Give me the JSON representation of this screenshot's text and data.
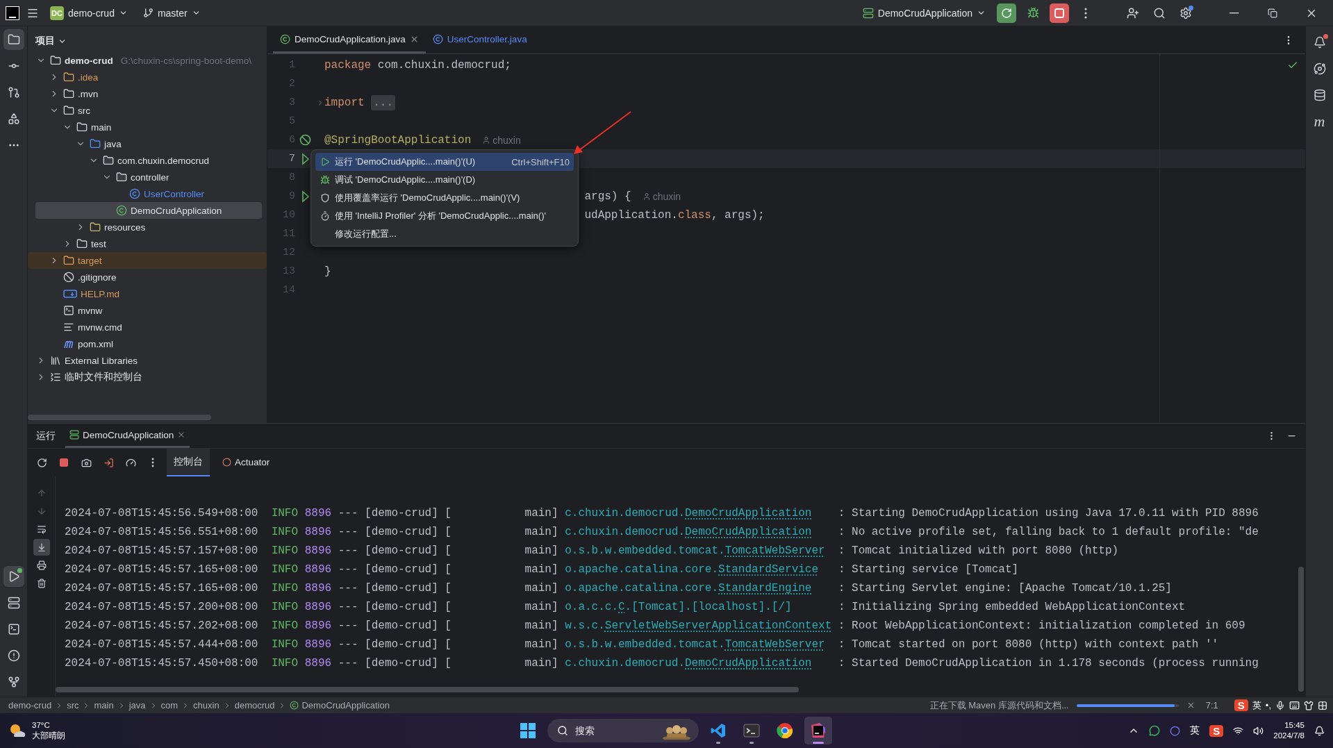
{
  "title_bar": {
    "project_badge": "DC",
    "project": "demo-crud",
    "branch": "master",
    "run_config": "DemoCrudApplication"
  },
  "left_tools": {
    "top": [
      {
        "kind": "project",
        "selected": true
      },
      {
        "kind": "commit",
        "selected": false
      },
      {
        "kind": "pull-requests",
        "selected": false
      },
      {
        "kind": "structure",
        "selected": false
      },
      {
        "kind": "more",
        "selected": false
      }
    ],
    "bottom": [
      {
        "kind": "run",
        "selected": true
      },
      {
        "kind": "services",
        "selected": false
      },
      {
        "kind": "terminal",
        "selected": false
      },
      {
        "kind": "problems",
        "selected": false
      },
      {
        "kind": "git",
        "selected": false
      }
    ]
  },
  "right_tools": [
    {
      "kind": "notifications"
    },
    {
      "kind": "assistant"
    },
    {
      "kind": "database"
    },
    {
      "kind": "maven",
      "glyph": "m"
    }
  ],
  "project": {
    "title": "项目",
    "tree": [
      {
        "name": "demo-crud",
        "path": "G:\\chuxin-cs\\spring-boot-demo\\",
        "kind": "module",
        "expanded": true,
        "selected": false,
        "children": [
          {
            "name": ".idea",
            "kind": "folder",
            "color": "#d69a5a",
            "expanded": false,
            "selected": false
          },
          {
            "name": ".mvn",
            "kind": "folder",
            "expanded": false,
            "selected": false
          },
          {
            "name": "src",
            "kind": "folder",
            "expanded": true,
            "selected": false,
            "children": [
              {
                "name": "main",
                "kind": "folder",
                "expanded": true,
                "selected": false,
                "children": [
                  {
                    "name": "java",
                    "kind": "source",
                    "expanded": true,
                    "selected": false,
                    "children": [
                      {
                        "name": "com.chuxin.democrud",
                        "kind": "package",
                        "expanded": true,
                        "selected": false,
                        "children": [
                          {
                            "name": "controller",
                            "kind": "package",
                            "expanded": true,
                            "selected": false,
                            "children": [
                              {
                                "name": "UserController",
                                "kind": "class",
                                "color": "#548af7",
                                "selected": false
                              }
                            ]
                          },
                          {
                            "name": "DemoCrudApplication",
                            "kind": "spring-class",
                            "selected": true
                          }
                        ]
                      }
                    ]
                  },
                  {
                    "name": "resources",
                    "kind": "resources",
                    "expanded": false,
                    "selected": false
                  }
                ]
              },
              {
                "name": "test",
                "kind": "folder",
                "expanded": false,
                "selected": false
              }
            ]
          },
          {
            "name": "target",
            "kind": "folder",
            "color": "#d69a5a",
            "excluded": true,
            "expanded": false,
            "selected": false
          },
          {
            "name": ".gitignore",
            "kind": "ignore",
            "selected": false
          },
          {
            "name": "HELP.md",
            "kind": "markdown",
            "color": "#d69a5a",
            "selected": false
          },
          {
            "name": "mvnw",
            "kind": "script",
            "selected": false
          },
          {
            "name": "mvnw.cmd",
            "kind": "text",
            "selected": false
          },
          {
            "name": "pom.xml",
            "kind": "maven",
            "selected": false
          }
        ]
      },
      {
        "name": "External Libraries",
        "kind": "libraries",
        "expanded": false,
        "selected": false
      },
      {
        "name": "临时文件和控制台",
        "kind": "scratches",
        "expanded": false,
        "selected": false
      }
    ]
  },
  "editor": {
    "tabs": [
      {
        "label": "DemoCrudApplication.java",
        "kind": "spring-class",
        "selected": true
      },
      {
        "label": "UserController.java",
        "kind": "class",
        "selected": false
      }
    ],
    "lines": [
      {
        "number": "1",
        "current": false,
        "tokens": [
          {
            "text": "package",
            "kind": "keyword"
          },
          {
            "text": " com.chuxin.democrud;",
            "kind": "plain"
          }
        ]
      },
      {
        "number": "2",
        "current": false
      },
      {
        "number": "3",
        "current": false,
        "kind": "fold",
        "tokens": [
          {
            "text": "import",
            "kind": "keyword"
          },
          {
            "text": "...",
            "kind": "folded"
          }
        ]
      },
      {
        "number": "5",
        "current": false
      },
      {
        "number": "6",
        "current": false,
        "kind": "bean",
        "author": "chuxin",
        "tokens": [
          {
            "text": "@SpringBootApplication",
            "kind": "annotation"
          }
        ]
      },
      {
        "number": "7",
        "current": true,
        "kind": "run"
      },
      {
        "number": "8",
        "current": false
      },
      {
        "number": "9",
        "current": false,
        "kind": "run",
        "clipped": true,
        "author": "chuxin",
        "tokens": [
          {
            "text": "args) {",
            "kind": "plain"
          }
        ]
      },
      {
        "number": "10",
        "current": false,
        "clipped": true,
        "tokens": [
          {
            "text": "udApplication.",
            "kind": "plain"
          },
          {
            "text": "class",
            "kind": "keyword"
          },
          {
            "text": ", args);",
            "kind": "plain"
          }
        ]
      },
      {
        "number": "11",
        "current": false
      },
      {
        "number": "12",
        "current": false
      },
      {
        "number": "13",
        "current": false,
        "tokens": [
          {
            "text": "}",
            "kind": "plain"
          }
        ]
      },
      {
        "number": "14",
        "current": false
      }
    ],
    "popup": [
      {
        "kind": "run",
        "label": "运行 'DemoCrudApplic....main()'(U)",
        "shortcut": "Ctrl+Shift+F10",
        "selected": true
      },
      {
        "kind": "debug",
        "label": "调试 'DemoCrudApplic....main()'(D)",
        "selected": false
      },
      {
        "kind": "coverage",
        "label": "使用覆盖率运行 'DemoCrudApplic....main()'(V)",
        "selected": false
      },
      {
        "kind": "profiler",
        "label": "使用 'IntelliJ Profiler' 分析  'DemoCrudApplic....main()'",
        "selected": false
      },
      {
        "kind": "plain",
        "label": "修改运行配置...",
        "selected": false
      }
    ]
  },
  "run_panel": {
    "title": "运行",
    "tabs": [
      {
        "label": "DemoCrudApplication",
        "selected": true
      }
    ],
    "subtabs": [
      {
        "label": "控制台",
        "kind": "console",
        "selected": true
      },
      {
        "label": "Actuator",
        "kind": "actuator",
        "selected": false
      }
    ],
    "gutter": [
      {
        "kind": "up",
        "selected": false
      },
      {
        "kind": "down",
        "selected": false
      },
      {
        "kind": "wrap",
        "selected": false
      },
      {
        "kind": "scroll-end",
        "selected": true
      },
      {
        "kind": "print",
        "selected": false
      },
      {
        "kind": "clear",
        "selected": false
      }
    ],
    "log": [
      {
        "timestamp": "2024-07-08T15:45:56.549+08:00",
        "level": "INFO",
        "pid": "8896",
        "sep": "---",
        "app": "[demo-crud]",
        "thread": "[           main]",
        "logger": "c.chuxin.democrud.",
        "logger_class": "DemoCrudApplication",
        "message": ": Starting DemoCrudApplication using Java 17.0.11 with PID 8896"
      },
      {
        "timestamp": "2024-07-08T15:45:56.551+08:00",
        "level": "INFO",
        "pid": "8896",
        "sep": "---",
        "app": "[demo-crud]",
        "thread": "[           main]",
        "logger": "c.chuxin.democrud.",
        "logger_class": "DemoCrudApplication",
        "message": ": No active profile set, falling back to 1 default profile: \"de"
      },
      {
        "timestamp": "2024-07-08T15:45:57.157+08:00",
        "level": "INFO",
        "pid": "8896",
        "sep": "---",
        "app": "[demo-crud]",
        "thread": "[           main]",
        "logger": "o.s.b.w.embedded.tomcat.",
        "logger_class": "TomcatWebServer",
        "message": ": Tomcat initialized with port 8080 (http)"
      },
      {
        "timestamp": "2024-07-08T15:45:57.165+08:00",
        "level": "INFO",
        "pid": "8896",
        "sep": "---",
        "app": "[demo-crud]",
        "thread": "[           main]",
        "logger": "o.apache.catalina.core.",
        "logger_class": "StandardService",
        "message": ": Starting service [Tomcat]"
      },
      {
        "timestamp": "2024-07-08T15:45:57.165+08:00",
        "level": "INFO",
        "pid": "8896",
        "sep": "---",
        "app": "[demo-crud]",
        "thread": "[           main]",
        "logger": "o.apache.catalina.core.",
        "logger_class": "StandardEngine",
        "message": ": Starting Servlet engine: [Apache Tomcat/10.1.25]"
      },
      {
        "timestamp": "2024-07-08T15:45:57.200+08:00",
        "level": "INFO",
        "pid": "8896",
        "sep": "---",
        "app": "[demo-crud]",
        "thread": "[           main]",
        "logger": "o.a.c.c.",
        "logger_class": "C",
        "logger_rest": ".[Tomcat].[localhost].[/]",
        "message": ": Initializing Spring embedded WebApplicationContext"
      },
      {
        "timestamp": "2024-07-08T15:45:57.202+08:00",
        "level": "INFO",
        "pid": "8896",
        "sep": "---",
        "app": "[demo-crud]",
        "thread": "[           main]",
        "logger": "w.s.c.",
        "logger_class": "ServletWebServerApplicationContext",
        "message": ": Root WebApplicationContext: initialization completed in 609"
      },
      {
        "timestamp": "2024-07-08T15:45:57.444+08:00",
        "level": "INFO",
        "pid": "8896",
        "sep": "---",
        "app": "[demo-crud]",
        "thread": "[           main]",
        "logger": "o.s.b.w.embedded.tomcat.",
        "logger_class": "TomcatWebServer",
        "message": ": Tomcat started on port 8080 (http) with context path ''"
      },
      {
        "timestamp": "2024-07-08T15:45:57.450+08:00",
        "level": "INFO",
        "pid": "8896",
        "sep": "---",
        "app": "[demo-crud]",
        "thread": "[           main]",
        "logger": "c.chuxin.democrud.",
        "logger_class": "DemoCrudApplication",
        "message": ": Started DemoCrudApplication in 1.178 seconds (process running"
      }
    ]
  },
  "status_bar": {
    "breadcrumbs": [
      "demo-crud",
      "src",
      "main",
      "java",
      "com",
      "chuxin",
      "democrud",
      "DemoCrudApplication"
    ],
    "task": "正在下载 Maven 库源代码和文档...",
    "level": 0.96,
    "position": "7:1",
    "ime": {
      "logo": "S",
      "mode": "英",
      "punct": "•,"
    }
  },
  "taskbar": {
    "weather": {
      "temp": "37°C",
      "desc": "大部晴朗"
    },
    "search": {
      "placeholder": "搜索"
    },
    "apps": [
      {
        "kind": "vscode",
        "running": true,
        "selected": false
      },
      {
        "kind": "terminal",
        "running": true,
        "selected": false
      },
      {
        "kind": "chrome",
        "running": false,
        "selected": false
      },
      {
        "kind": "intellij",
        "running": true,
        "selected": true
      }
    ],
    "ime": "英",
    "ime_logo": "S",
    "time": "15:45",
    "date": "2024/7/8"
  }
}
